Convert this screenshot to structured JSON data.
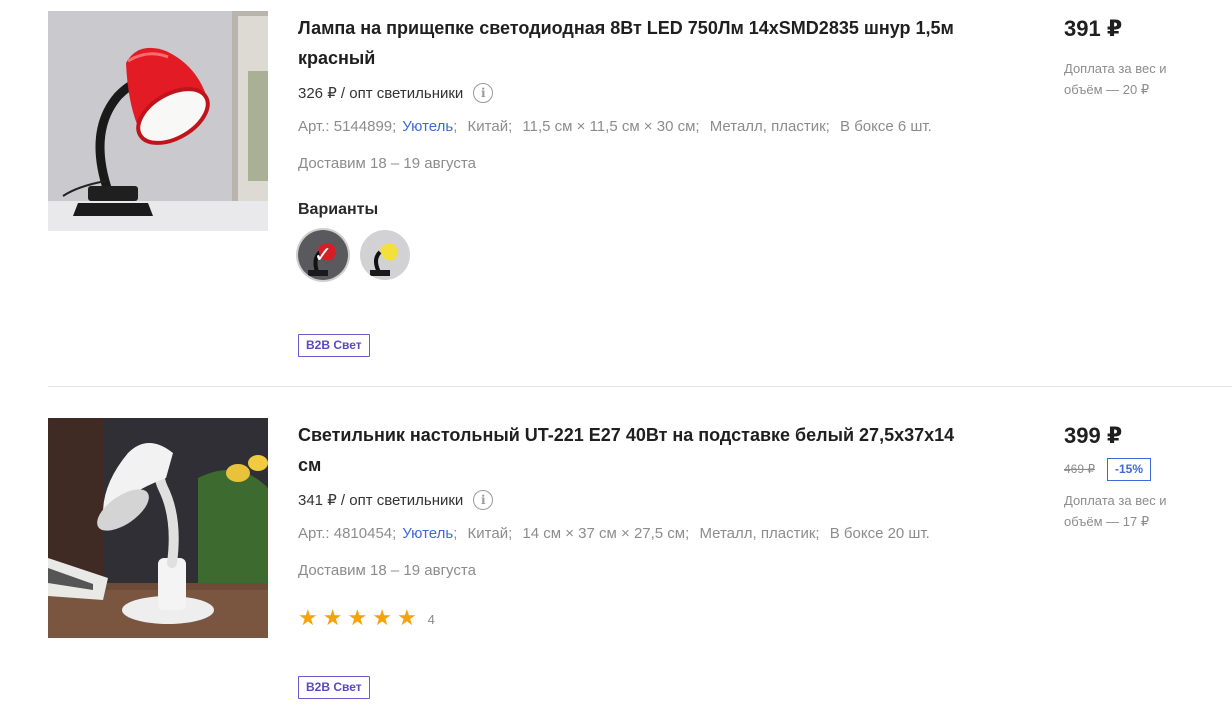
{
  "products": [
    {
      "title": "Лампа на прищепке светодиодная 8Вт LED 750Лм 14xSMD2835 шнур 1,5м красный",
      "opt_price": "326 ₽ / опт светильники",
      "specs": {
        "art": "Арт.: 5144899;",
        "brand": "Уютель",
        "country": "Китай;",
        "size": "11,5 см × 11,5 см × 30 см;",
        "material": "Металл, пластик;",
        "box": "В боксе 6 шт."
      },
      "delivery": "Доставим 18 – 19 августа",
      "variants_label": "Варианты",
      "variants": [
        {
          "name": "red",
          "color": "#e02828",
          "selected": true
        },
        {
          "name": "yellow",
          "color": "#f2e04a",
          "selected": false
        }
      ],
      "badge": "B2B Свет",
      "price": "391 ₽",
      "surcharge": "Доплата за вес и объём — 20 ₽"
    },
    {
      "title": "Светильник настольный UT-221 E27 40Вт на подставке белый 27,5х37х14 см",
      "opt_price": "341 ₽ / опт светильники",
      "specs": {
        "art": "Арт.: 4810454;",
        "brand": "Уютель",
        "country": "Китай;",
        "size": "14 см × 37 см × 27,5 см;",
        "material": "Металл, пластик;",
        "box": "В боксе 20 шт."
      },
      "delivery": "Доставим 18 – 19 августа",
      "rating": 5,
      "reviews_count": "4",
      "badge": "B2B Свет",
      "price": "399 ₽",
      "old_price": "469 ₽",
      "discount": "-15%",
      "surcharge": "Доплата за вес и объём — 17 ₽"
    }
  ],
  "icons": {
    "info": "i",
    "star": "★",
    "check": "✓"
  },
  "colors": {
    "accent_blue": "#3e6ad6",
    "badge_purple": "#5a49bf",
    "star_orange": "#f5a30a"
  }
}
